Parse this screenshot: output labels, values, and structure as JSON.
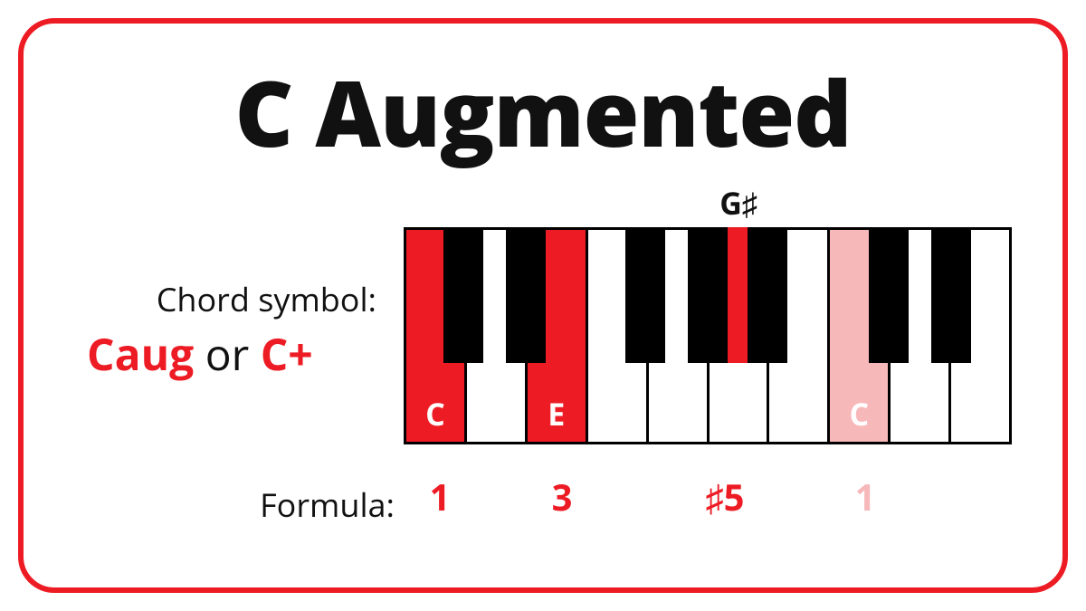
{
  "title": "C Augmented",
  "chord_symbol": {
    "label": "Chord symbol:",
    "primary": "Caug",
    "connector": " or ",
    "secondary": "C+"
  },
  "black_key_label": "G♯",
  "keyboard": {
    "white_keys": [
      {
        "note": "C",
        "highlight": "hi"
      },
      {
        "note": "",
        "highlight": ""
      },
      {
        "note": "E",
        "highlight": "hi"
      },
      {
        "note": "",
        "highlight": ""
      },
      {
        "note": "",
        "highlight": ""
      },
      {
        "note": "",
        "highlight": ""
      },
      {
        "note": "",
        "highlight": ""
      },
      {
        "note": "C",
        "highlight": "faded"
      },
      {
        "note": "",
        "highlight": ""
      },
      {
        "note": "",
        "highlight": ""
      }
    ]
  },
  "formula": {
    "label": "Formula:",
    "degrees": [
      {
        "text": "1",
        "faded": false
      },
      {
        "text": "3",
        "faded": false
      },
      {
        "text": "♯5",
        "faded": false
      },
      {
        "text": "1",
        "faded": true
      }
    ]
  },
  "chart_data": {
    "type": "table",
    "title": "C Augmented chord",
    "chord_symbols": [
      "Caug",
      "C+"
    ],
    "notes": [
      "C",
      "E",
      "G♯"
    ],
    "optional_octave_note": "C",
    "formula": [
      "1",
      "3",
      "♯5",
      "1"
    ],
    "highlighted_keys": [
      {
        "key": "C",
        "type": "white",
        "role": "root"
      },
      {
        "key": "E",
        "type": "white",
        "role": "major-third"
      },
      {
        "key": "G♯",
        "type": "black",
        "role": "augmented-fifth"
      },
      {
        "key": "C",
        "type": "white",
        "role": "octave-optional"
      }
    ]
  }
}
